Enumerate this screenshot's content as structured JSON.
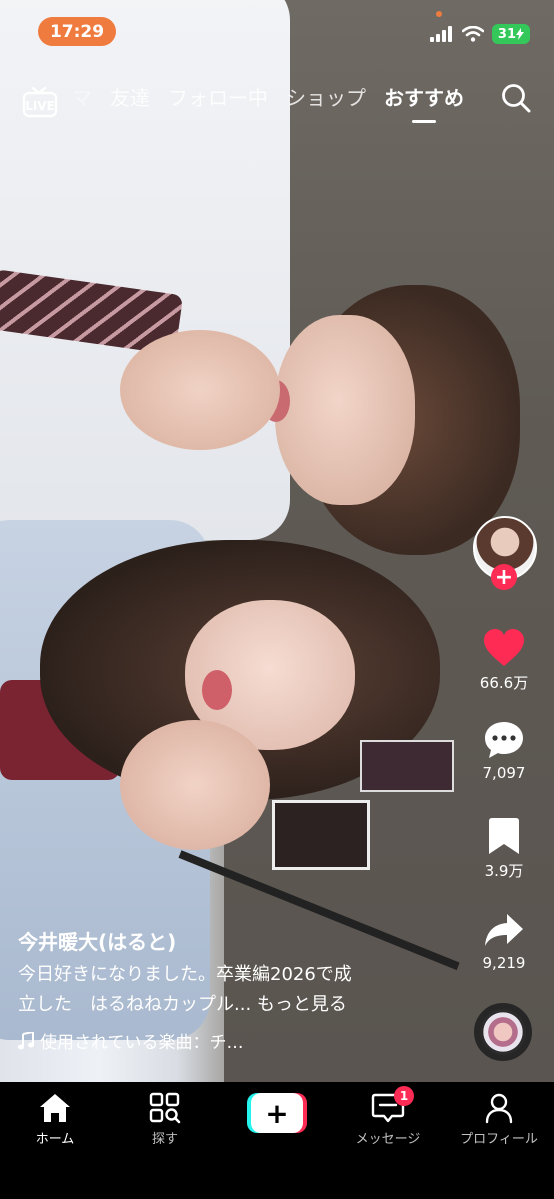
{
  "status": {
    "time": "17:29",
    "battery": "31"
  },
  "topnav": {
    "live_label": "LIVE",
    "tabs": [
      {
        "label": "マ"
      },
      {
        "label": "友達"
      },
      {
        "label": "フォロー中"
      },
      {
        "label": "ショップ"
      },
      {
        "label": "おすすめ",
        "active": true
      }
    ]
  },
  "rail": {
    "likes": "66.6万",
    "comments": "7,097",
    "saves": "3.9万",
    "shares": "9,219"
  },
  "caption": {
    "username": "今井暖大(はると)",
    "description_line1": "今日好きになりました。卒業編2026で成",
    "description_line2": "立した　はるねねカップル...",
    "more": "もっと見る",
    "music": "使用されている楽曲：チ…"
  },
  "bottomnav": {
    "home": "ホーム",
    "discover": "探す",
    "inbox": "メッセージ",
    "inbox_badge": "1",
    "profile": "プロフィール"
  },
  "colors": {
    "accent": "#fe2c55",
    "status_pill": "#f07b3f",
    "battery": "#34c759"
  }
}
